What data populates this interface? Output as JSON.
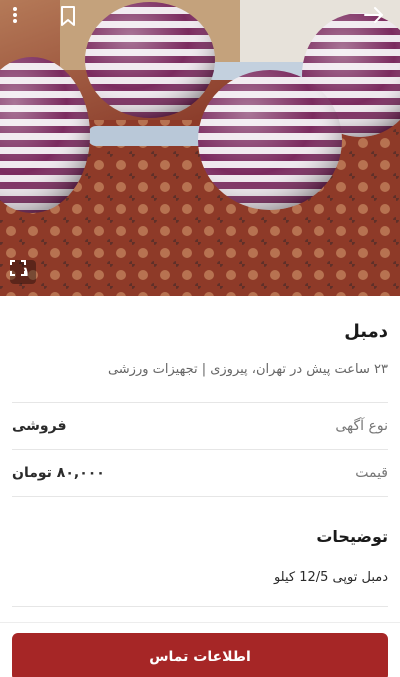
{
  "gallery": {
    "counter": "۱",
    "icons": {
      "menu": "more-vertical-icon",
      "bookmark": "bookmark-icon",
      "back": "arrow-right-icon",
      "fullscreen": "expand-icon"
    }
  },
  "ad": {
    "title": "دمبل",
    "subtitle": "۲۳ ساعت پیش در تهران، پیروزی | تجهیزات ورزشی",
    "fields": [
      {
        "label": "نوع آگهی",
        "value": "فروشی"
      },
      {
        "label": "قیمت",
        "value": "۸۰,۰۰۰ تومان"
      }
    ],
    "description_title": "توضیحات",
    "description": "دمبل توپی 12/5 کیلو"
  },
  "actions": {
    "contact_label": "اطلاعات تماس"
  },
  "colors": {
    "primary": "#a62626",
    "ball_stripe": "#7a2a5e",
    "ball_light": "#f2eef0"
  }
}
